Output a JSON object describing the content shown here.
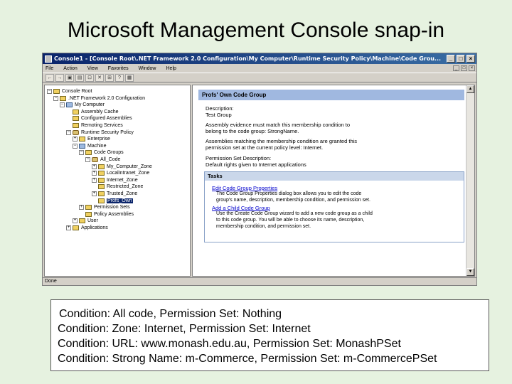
{
  "slide": {
    "title": "Microsoft Management Console snap-in"
  },
  "window": {
    "title": "Console1 - [Console Root\\.NET Framework 2.0 Configuration\\My Computer\\Runtime Security Policy\\Machine\\Code Grou...",
    "controls": [
      "_",
      "□",
      "×"
    ]
  },
  "menu": {
    "items": [
      "File",
      "Action",
      "View",
      "Favorites",
      "Window",
      "Help"
    ]
  },
  "toolbar": {
    "buttons": [
      "←",
      "→",
      "▣",
      "▤",
      "⊡",
      "✕",
      "⊞",
      "?",
      "▦"
    ]
  },
  "tree": {
    "nodes": [
      {
        "label": "Console Root",
        "level": 0,
        "expander": "−",
        "icon": "folder"
      },
      {
        "label": ".NET Framework 2.0 Configuration",
        "level": 1,
        "expander": "−",
        "icon": "folder"
      },
      {
        "label": "My Computer",
        "level": 2,
        "expander": "−",
        "icon": "pc"
      },
      {
        "label": "Assembly Cache",
        "level": 3,
        "expander": "",
        "icon": "folder"
      },
      {
        "label": "Configured Assemblies",
        "level": 3,
        "expander": "",
        "icon": "folder"
      },
      {
        "label": "Remoting Services",
        "level": 3,
        "expander": "",
        "icon": "folder"
      },
      {
        "label": "Runtime Security Policy",
        "level": 3,
        "expander": "−",
        "icon": "key"
      },
      {
        "label": "Enterprise",
        "level": 4,
        "expander": "+",
        "icon": "folder"
      },
      {
        "label": "Machine",
        "level": 4,
        "expander": "−",
        "icon": "pc"
      },
      {
        "label": "Code Groups",
        "level": 5,
        "expander": "−",
        "icon": "folder"
      },
      {
        "label": "All_Code",
        "level": 6,
        "expander": "−",
        "icon": "key"
      },
      {
        "label": "My_Computer_Zone",
        "level": 7,
        "expander": "+",
        "icon": "folder"
      },
      {
        "label": "LocalIntranet_Zone",
        "level": 7,
        "expander": "+",
        "icon": "folder"
      },
      {
        "label": "Internet_Zone",
        "level": 7,
        "expander": "+",
        "icon": "folder"
      },
      {
        "label": "Restricted_Zone",
        "level": 7,
        "expander": "",
        "icon": "folder"
      },
      {
        "label": "Trusted_Zone",
        "level": 7,
        "expander": "+",
        "icon": "folder"
      },
      {
        "label": "Profs_Own",
        "level": 7,
        "expander": "",
        "icon": "folder",
        "selected": true
      },
      {
        "label": "Permission Sets",
        "level": 5,
        "expander": "+",
        "icon": "folder"
      },
      {
        "label": "Policy Assemblies",
        "level": 5,
        "expander": "",
        "icon": "folder"
      },
      {
        "label": "User",
        "level": 4,
        "expander": "+",
        "icon": "folder"
      },
      {
        "label": "Applications",
        "level": 3,
        "expander": "+",
        "icon": "folder"
      }
    ]
  },
  "code_group": {
    "header": "Profs' Own Code Group",
    "lines": [
      "Description:",
      "Test Group",
      "Assembly evidence must match this membership condition to",
      "belong to the code group: StrongName.",
      "Assemblies matching the membership condition are granted this",
      "permission set at the current policy level: Internet.",
      "Permission Set Description:",
      "Default rights given to Internet applications"
    ]
  },
  "tasks": {
    "header": "Tasks",
    "links": [
      {
        "label": "Edit Code Group Properties",
        "desc": [
          "The Code Group Properties dialog box allows you to edit the code",
          "group's name, description, membership condition, and permission set."
        ]
      },
      {
        "label": "Add a Child Code Group",
        "desc": [
          "Use the Create Code Group wizard to add a new code group as a child",
          "to this code group. You will be able to choose its name, description,",
          "membership condition, and permission set."
        ]
      }
    ]
  },
  "status": {
    "text": "Done"
  },
  "conditions": [
    "Condition: All code, Permission Set: Nothing",
    "Condition: Zone: Internet, Permission Set: Internet",
    "Condition: URL: www.monash.edu.au, Permission Set: MonashPSet",
    "Condition: Strong Name: m-Commerce, Permission Set: m-CommercePSet"
  ]
}
